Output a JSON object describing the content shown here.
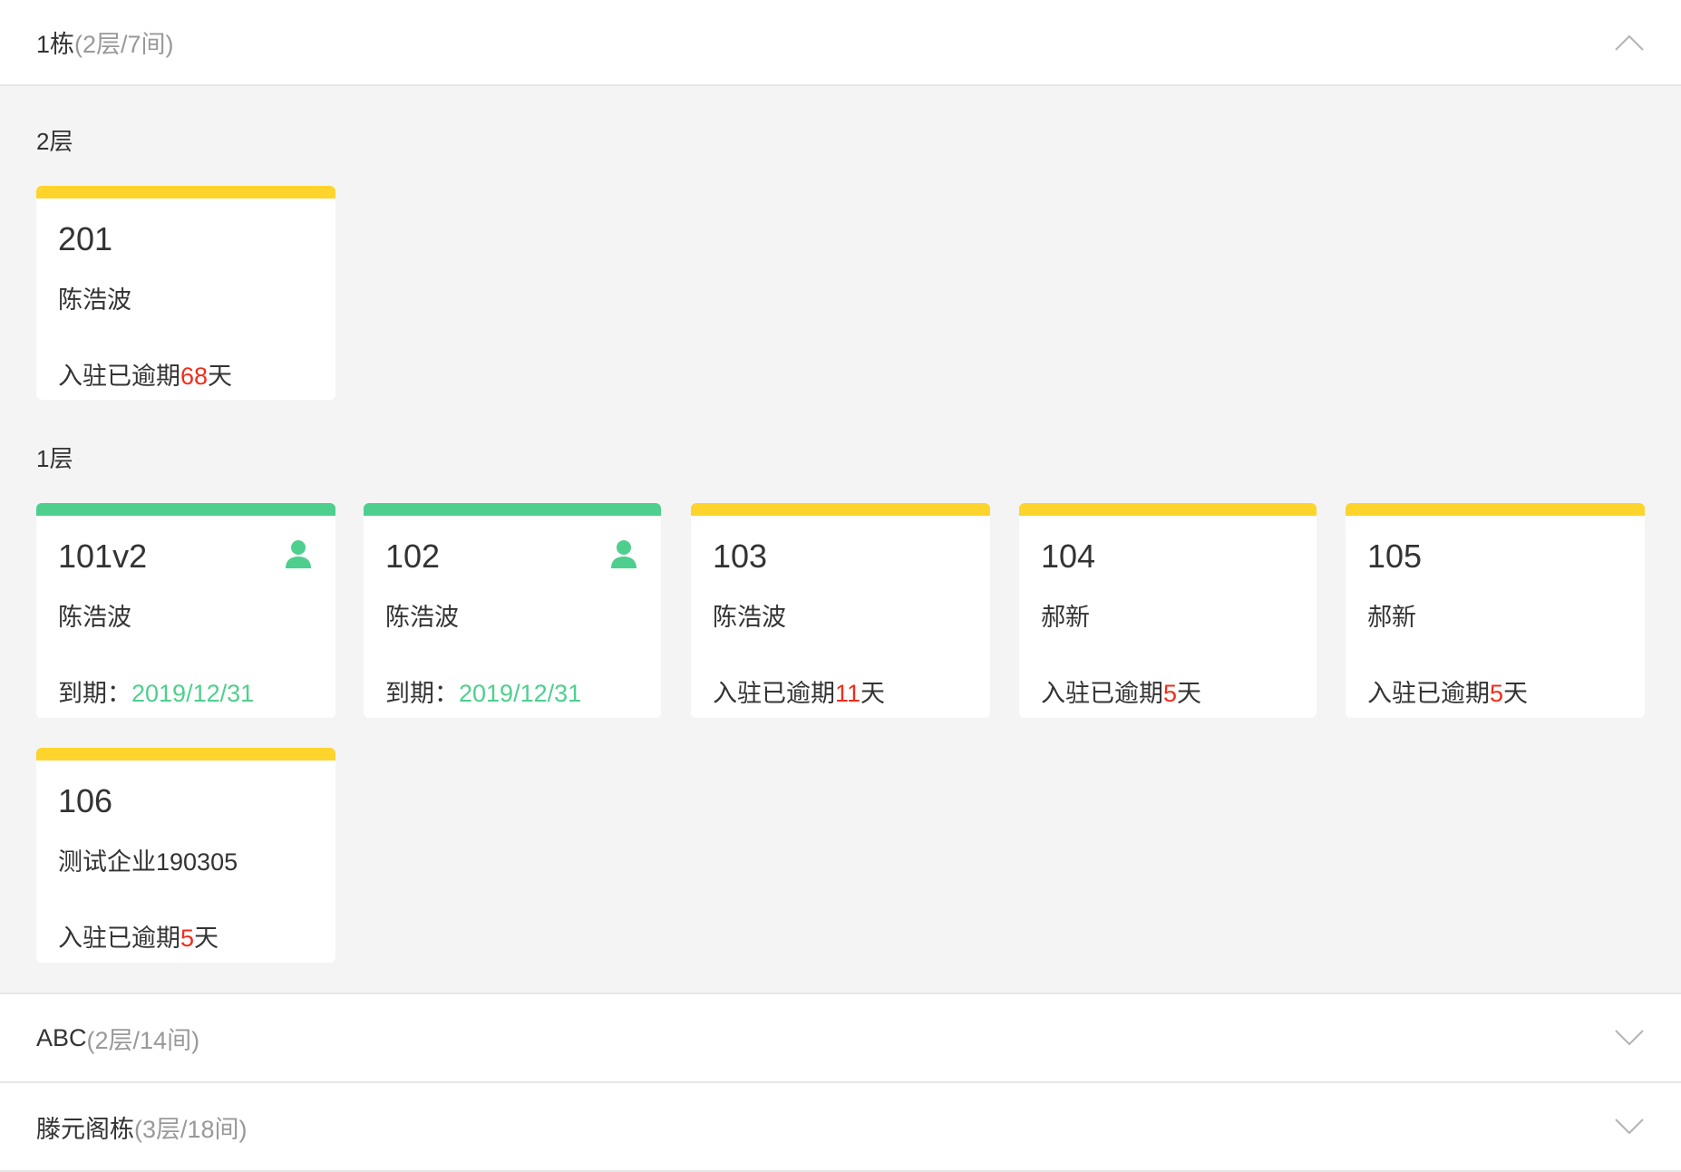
{
  "buildings": [
    {
      "name": "1栋",
      "meta": "(2层/7间)",
      "expanded": true,
      "floors": [
        {
          "label": "2层",
          "rooms": [
            {
              "no": "201",
              "tenant": "陈浩波",
              "bar": "yellow",
              "status_prefix": "入驻已逾期",
              "status_value": "68",
              "status_suffix": "天",
              "occupied": false
            }
          ]
        },
        {
          "label": "1层",
          "rooms": [
            {
              "no": "101v2",
              "tenant": "陈浩波",
              "bar": "green",
              "status_prefix": "到期：",
              "status_value": "2019/12/31",
              "status_suffix": "",
              "occupied": true
            },
            {
              "no": "102",
              "tenant": "陈浩波",
              "bar": "green",
              "status_prefix": "到期：",
              "status_value": "2019/12/31",
              "status_suffix": "",
              "occupied": true
            },
            {
              "no": "103",
              "tenant": "陈浩波",
              "bar": "yellow",
              "status_prefix": "入驻已逾期",
              "status_value": "11",
              "status_suffix": "天",
              "occupied": false
            },
            {
              "no": "104",
              "tenant": "郝新",
              "bar": "yellow",
              "status_prefix": "入驻已逾期",
              "status_value": "5",
              "status_suffix": "天",
              "occupied": false
            },
            {
              "no": "105",
              "tenant": "郝新",
              "bar": "yellow",
              "status_prefix": "入驻已逾期",
              "status_value": "5",
              "status_suffix": "天",
              "occupied": false
            },
            {
              "no": "106",
              "tenant": "测试企业190305",
              "bar": "yellow",
              "status_prefix": "入驻已逾期",
              "status_value": "5",
              "status_suffix": "天",
              "occupied": false
            }
          ]
        }
      ]
    },
    {
      "name": "ABC",
      "meta": "(2层/14间)",
      "expanded": false
    },
    {
      "name": "滕元阁栋",
      "meta": "(3层/18间)",
      "expanded": false
    }
  ],
  "icons": {
    "collapse": "chevron-up-icon",
    "expand": "chevron-down-icon",
    "occupied": "person-icon"
  },
  "colors": {
    "yellow_bar": "#fdd42c",
    "green_bar": "#4ecf8e",
    "overdue_number": "#f22c1a",
    "due_date": "#4ecf8e",
    "meta_text": "#999999",
    "body_background": "#f4f4f4"
  }
}
